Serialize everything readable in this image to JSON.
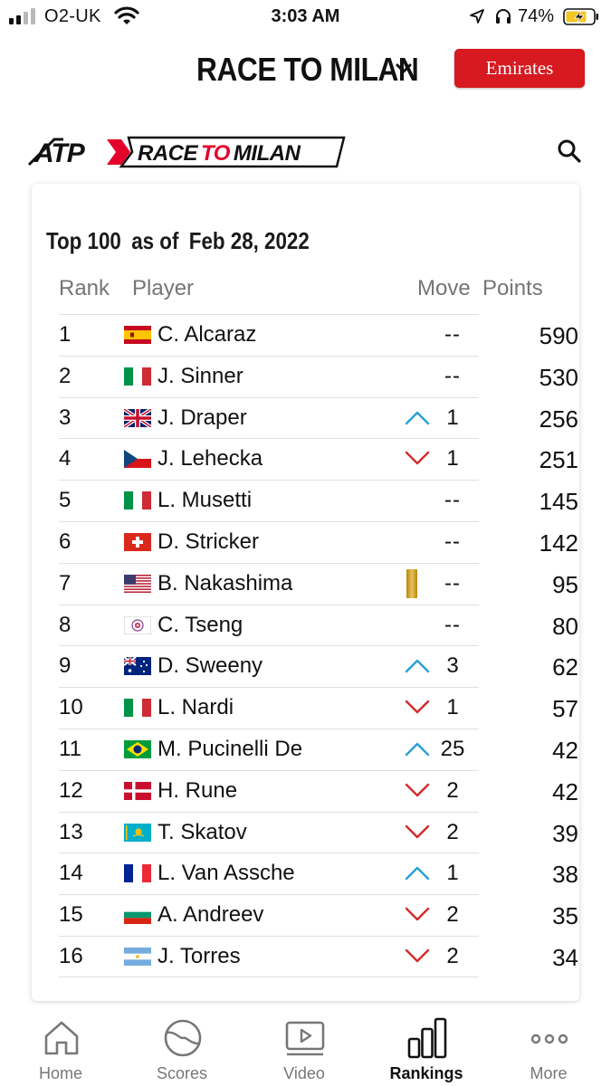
{
  "status_bar": {
    "carrier": "O2-UK",
    "time": "3:03 AM",
    "battery": "74%"
  },
  "header": {
    "title": "RACE TO MILAN",
    "sponsor": "Emirates"
  },
  "logo": {
    "atp": "ATP",
    "race": "RACE",
    "to": "TO",
    "milan": "MILAN"
  },
  "card": {
    "title_top": "Top 100",
    "title_asof": "as of",
    "title_date": "Feb 28, 2022"
  },
  "table": {
    "headers": {
      "rank": "Rank",
      "player": "Player",
      "move": "Move",
      "points": "Points"
    },
    "rows": [
      {
        "rank": "1",
        "flag": "spain-flag",
        "player": "C. Alcaraz",
        "direction": "none",
        "move": "--",
        "points": "590"
      },
      {
        "rank": "2",
        "flag": "italy-flag",
        "player": "J. Sinner",
        "direction": "none",
        "move": "--",
        "points": "530"
      },
      {
        "rank": "3",
        "flag": "uk-flag",
        "player": "J. Draper",
        "direction": "up",
        "move": "1",
        "points": "256"
      },
      {
        "rank": "4",
        "flag": "czech-flag",
        "player": "J. Lehecka",
        "direction": "down",
        "move": "1",
        "points": "251"
      },
      {
        "rank": "5",
        "flag": "italy-flag",
        "player": "L. Musetti",
        "direction": "none",
        "move": "--",
        "points": "145"
      },
      {
        "rank": "6",
        "flag": "switzerland-flag",
        "player": "D. Stricker",
        "direction": "none",
        "move": "--",
        "points": "142"
      },
      {
        "rank": "7",
        "flag": "usa-flag",
        "player": "B. Nakashima",
        "direction": "none",
        "move": "--",
        "points": "95",
        "gold_bar": true
      },
      {
        "rank": "8",
        "flag": "chinese-taipei-flag",
        "player": "C. Tseng",
        "direction": "none",
        "move": "--",
        "points": "80"
      },
      {
        "rank": "9",
        "flag": "australia-flag",
        "player": "D. Sweeny",
        "direction": "up",
        "move": "3",
        "points": "62"
      },
      {
        "rank": "10",
        "flag": "italy-flag",
        "player": "L. Nardi",
        "direction": "down",
        "move": "1",
        "points": "57"
      },
      {
        "rank": "11",
        "flag": "brazil-flag",
        "player": "M. Pucinelli De",
        "direction": "up",
        "move": "25",
        "points": "42"
      },
      {
        "rank": "12",
        "flag": "denmark-flag",
        "player": "H. Rune",
        "direction": "down",
        "move": "2",
        "points": "42"
      },
      {
        "rank": "13",
        "flag": "kazakhstan-flag",
        "player": "T. Skatov",
        "direction": "down",
        "move": "2",
        "points": "39"
      },
      {
        "rank": "14",
        "flag": "france-flag",
        "player": "L. Van Assche",
        "direction": "up",
        "move": "1",
        "points": "38"
      },
      {
        "rank": "15",
        "flag": "bulgaria-flag",
        "player": "A. Andreev",
        "direction": "down",
        "move": "2",
        "points": "35"
      },
      {
        "rank": "16",
        "flag": "argentina-flag",
        "player": "J. Torres",
        "direction": "down",
        "move": "2",
        "points": "34"
      }
    ]
  },
  "tabbar": {
    "items": [
      {
        "label": "Home",
        "icon": "home-icon",
        "active": false
      },
      {
        "label": "Scores",
        "icon": "tennis-ball-icon",
        "active": false
      },
      {
        "label": "Video",
        "icon": "video-play-icon",
        "active": false
      },
      {
        "label": "Rankings",
        "icon": "rankings-bars-icon",
        "active": true
      },
      {
        "label": "More",
        "icon": "more-dots-icon",
        "active": false
      }
    ]
  },
  "colors": {
    "up_arrow": "#2a9fd6",
    "down_arrow": "#d42a2a",
    "sponsor_red": "#d71920",
    "accent_red": "#e4002b"
  }
}
